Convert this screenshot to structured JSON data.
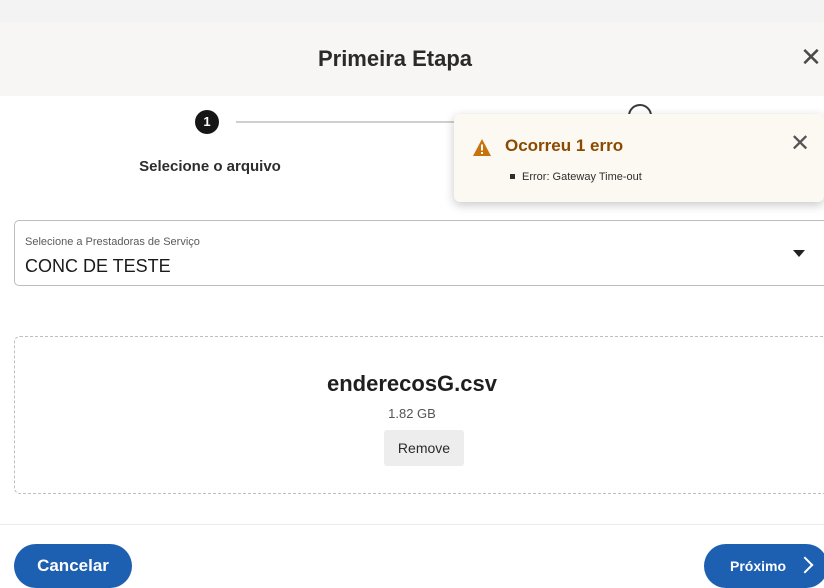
{
  "dialog": {
    "title": "Primeira Etapa",
    "close_icon": "close-icon"
  },
  "stepper": {
    "steps": [
      {
        "number": "1",
        "label": "Selecione o arquivo",
        "state": "active"
      },
      {
        "number": "",
        "label": "",
        "state": "pending"
      }
    ]
  },
  "toast": {
    "title": "Ocorreu 1 erro",
    "icon": "warning-icon",
    "errors": [
      "Error: Gateway Time-out"
    ],
    "colors": {
      "title": "#8a4a00",
      "icon": "#c7720a",
      "background": "#fcf8f2"
    }
  },
  "select": {
    "label": "Selecione a Prestadoras de Serviço",
    "value": "CONC DE TESTE",
    "icon": "caret-down-icon"
  },
  "file": {
    "name": "enderecosG.csv",
    "size": "1.82 GB",
    "remove_label": "Remove"
  },
  "footer": {
    "cancel_label": "Cancelar",
    "next_label": "Próximo",
    "next_icon": "chevron-right-icon"
  },
  "colors": {
    "accent": "#1d5fb0"
  }
}
